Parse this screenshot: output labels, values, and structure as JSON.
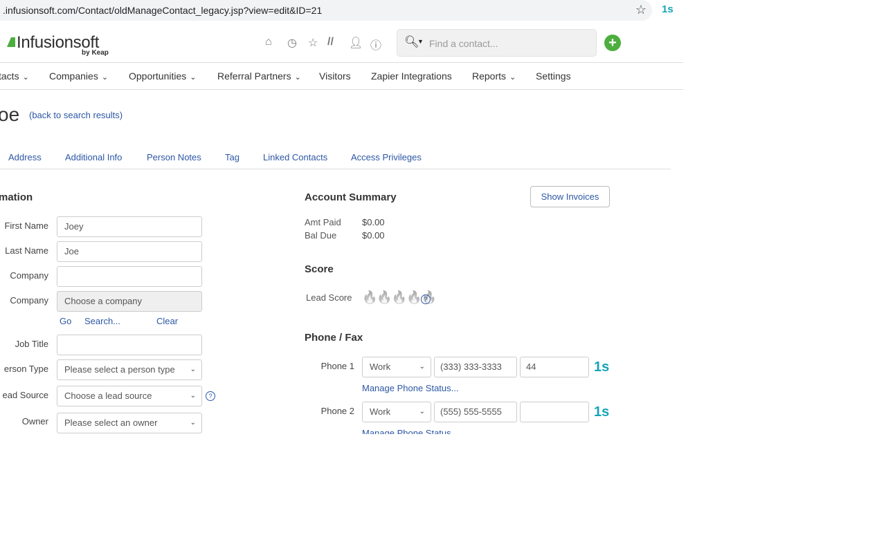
{
  "browser": {
    "url": ".infusionsoft.com/Contact/oldManageContact_legacy.jsp?view=edit&ID=21",
    "star_icon": "star-icon",
    "extension_icon_text": "1s"
  },
  "header": {
    "logo_text": "Infusionsoft",
    "logo_sub": "by Keap",
    "search_placeholder": "Find a contact...",
    "add_label": "+"
  },
  "nav": {
    "items": [
      {
        "label": "tacts"
      },
      {
        "label": "Companies"
      },
      {
        "label": "Opportunities"
      },
      {
        "label": "Referral Partners"
      },
      {
        "label": "Visitors"
      },
      {
        "label": "Zapier Integrations"
      },
      {
        "label": "Reports"
      },
      {
        "label": "Settings"
      }
    ]
  },
  "page": {
    "title": "oe",
    "back_link": "(back to search results)"
  },
  "tabs": [
    {
      "label": "Address"
    },
    {
      "label": "Additional Info"
    },
    {
      "label": "Person Notes"
    },
    {
      "label": "Tag"
    },
    {
      "label": "Linked Contacts"
    },
    {
      "label": "Access Privileges"
    }
  ],
  "info": {
    "section_title": "mation",
    "first_name_label": "First Name",
    "first_name_value": "Joey",
    "last_name_label": "Last Name",
    "last_name_value": "Joe",
    "company_label": "Company",
    "company_value": "",
    "company2_label": "Company",
    "company2_value": "Choose a company",
    "go_link": "Go",
    "search_link": "Search...",
    "clear_link": "Clear",
    "job_title_label": "Job Title",
    "job_title_value": "",
    "person_type_label": "erson Type",
    "person_type_value": "Please select a person type",
    "lead_source_label": "ead Source",
    "lead_source_value": "Choose a lead source",
    "owner_label": "Owner",
    "owner_value": "Please select an owner"
  },
  "account": {
    "title": "Account Summary",
    "show_invoices": "Show Invoices",
    "amt_paid_label": "Amt Paid",
    "amt_paid_value": "$0.00",
    "bal_due_label": "Bal Due",
    "bal_due_value": "$0.00"
  },
  "score": {
    "title": "Score",
    "lead_score_label": "Lead Score",
    "flames": "🔥🔥🔥🔥🔥"
  },
  "phone": {
    "title": "Phone / Fax",
    "phone1_label": "Phone 1",
    "phone1_type": "Work",
    "phone1_number": "(333) 333-3333",
    "phone1_ext": "44",
    "phone1_manage": "Manage Phone Status...",
    "phone2_label": "Phone 2",
    "phone2_type": "Work",
    "phone2_number": "(555) 555-5555",
    "phone2_ext": "",
    "phone2_manage": "Manage Phone Status..."
  }
}
